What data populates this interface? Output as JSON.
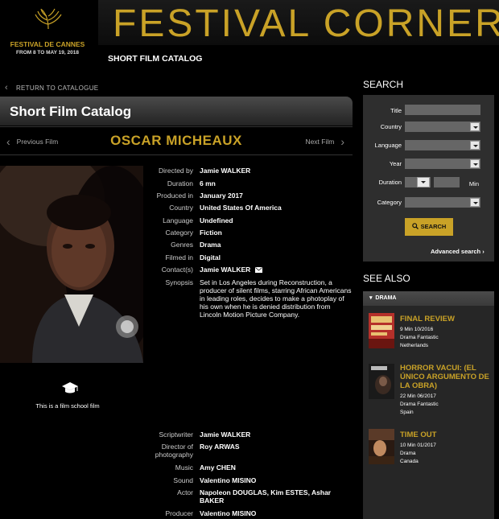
{
  "header": {
    "logo_line1": "FESTIVAL DE CANNES",
    "logo_line2": "FROM 8 TO MAY 19, 2018",
    "title": "FESTIVAL CORNER",
    "subtitle": "SHORT FILM CATALOG"
  },
  "nav": {
    "return_label": "RETURN TO CATALOGUE",
    "catalog_title": "Short Film Catalog",
    "prev_label": "Previous Film",
    "next_label": "Next Film",
    "film_name": "OSCAR MICHEAUX"
  },
  "film": {
    "school_label": "This is a film school film",
    "details": [
      {
        "label": "Directed by",
        "value": "Jamie WALKER"
      },
      {
        "label": "Duration",
        "value": "6 mn"
      },
      {
        "label": "Produced in",
        "value": "January 2017"
      },
      {
        "label": "Country",
        "value": "United States Of America"
      },
      {
        "label": "Language",
        "value": "Undefined"
      },
      {
        "label": "Category",
        "value": "Fiction"
      },
      {
        "label": "Genres",
        "value": "Drama"
      },
      {
        "label": "Filmed in",
        "value": "Digital"
      },
      {
        "label": "Contact(s)",
        "value": "Jamie WALKER"
      },
      {
        "label": "Synopsis",
        "value": "Set in Los Angeles during Reconstruction, a producer of silent films, starring African Americans in leading roles, decides to make a photoplay of his own when he is denied distribution from Lincoln Motion Picture Company."
      }
    ],
    "credits": [
      {
        "label": "Scriptwriter",
        "value": "Jamie WALKER"
      },
      {
        "label": "Director of photography",
        "value": "Roy ARWAS"
      },
      {
        "label": "Music",
        "value": "Amy CHEN"
      },
      {
        "label": "Sound",
        "value": "Valentino MISINO"
      },
      {
        "label": "Actor",
        "value": "Napoleon DOUGLAS, Kim ESTES, Ashar BAKER"
      },
      {
        "label": "Producer",
        "value": "Valentino MISINO"
      }
    ]
  },
  "search": {
    "heading": "SEARCH",
    "title_label": "Title",
    "country_label": "Country",
    "language_label": "Language",
    "year_label": "Year",
    "duration_label": "Duration",
    "duration_unit": "Min",
    "category_label": "Category",
    "button_label": "SEARCH",
    "advanced_label": "Advanced search"
  },
  "see_also": {
    "heading": "SEE ALSO",
    "category": "DRAMA",
    "items": [
      {
        "title": "FINAL REVIEW",
        "meta1": "9 Min 10/2016",
        "meta2": "Drama Fantastic",
        "meta3": "Netherlands"
      },
      {
        "title": "HORROR VACUI: (EL ÚNICO ARGUMENTO DE LA OBRA)",
        "meta1": "22 Min 06/2017",
        "meta2": "Drama Fantastic",
        "meta3": "Spain"
      },
      {
        "title": "TIME OUT",
        "meta1": "10 Min 01/2017",
        "meta2": "Drama",
        "meta3": "Canada"
      }
    ]
  },
  "colors": {
    "accent": "#c9a227",
    "panel": "#2e2e2e",
    "background": "#000000"
  },
  "icons": [
    "palm-logo-icon",
    "chevron-left-icon",
    "chevron-right-icon",
    "graduation-cap-icon",
    "mail-icon",
    "search-icon",
    "dropdown-icon"
  ]
}
